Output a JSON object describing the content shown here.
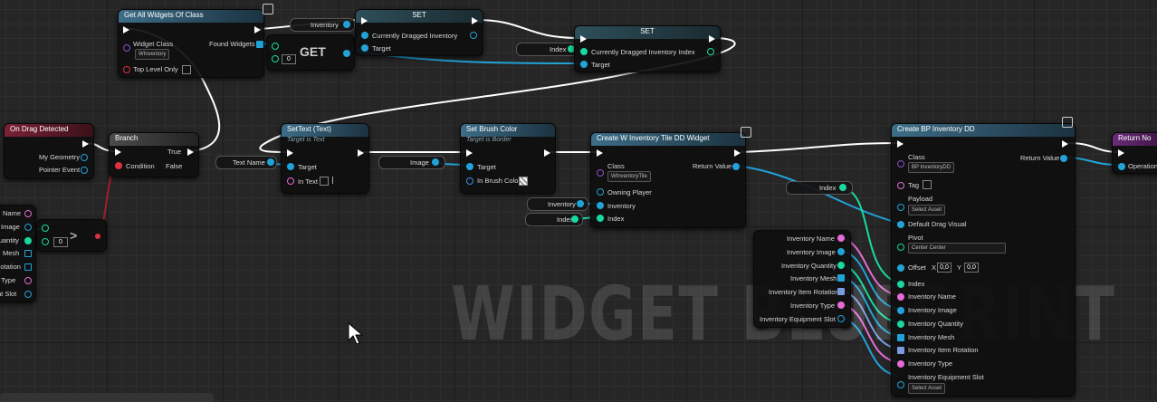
{
  "watermark": "WIDGET BLUEPRINT",
  "colors": {
    "exec": "#ffffff",
    "object": "#22a3d8",
    "int": "#19d9a0",
    "string": "#e66bd6",
    "bool": "#e03040"
  },
  "nodes": {
    "get_all_widgets": {
      "title": "Get All Widgets Of Class",
      "widget_class": "Widget Class",
      "class_value": "WInventory",
      "found_widgets": "Found Widgets",
      "top_level_only": "Top Level Only"
    },
    "get": {
      "title": "GET",
      "index_value": "0"
    },
    "set1": {
      "title": "SET",
      "inventory": "Inventory",
      "pin": "Currently Dragged Inventory",
      "target": "Target"
    },
    "set2": {
      "title": "SET",
      "index": "Index",
      "pin": "Currently Dragged Inventory Index",
      "target": "Target"
    },
    "on_drag": {
      "title": "On Drag Detected",
      "my_geometry": "My Geometry",
      "pointer_event": "Pointer Event"
    },
    "branch": {
      "title": "Branch",
      "condition": "Condition",
      "true": "True",
      "false": "False"
    },
    "settext": {
      "title": "SetText (Text)",
      "subtitle": "Target is Text",
      "target": "Target",
      "in_text": "In Text",
      "text_name": "Text Name"
    },
    "setbrush": {
      "title": "Set Brush Color",
      "subtitle": "Target is Border",
      "target": "Target",
      "in_brush": "In Brush Color",
      "image": "Image"
    },
    "create_w": {
      "title": "Create W Inventory Tile DD Widget",
      "class": "Class",
      "class_value": "WInventoryTile",
      "return_value": "Return Value",
      "owning_player": "Owning Player",
      "inventory": "Inventory",
      "index": "Index",
      "inv_reroute": "Inventory",
      "index_reroute": "Index"
    },
    "create_bp": {
      "title": "Create BP Inventory DD",
      "class": "Class",
      "class_value": "BP InventoryDD",
      "return_value": "Return Value",
      "tag": "Tag",
      "payload": "Payload",
      "payload_value": "Select Asset",
      "default_drag": "Default Drag Visual",
      "pivot": "Pivot",
      "pivot_value": "Center Center",
      "offset": "Offset",
      "offset_x_label": "X",
      "offset_x": "0,0",
      "offset_y_label": "Y",
      "offset_y": "0,0",
      "index": "Index",
      "inv_name": "Inventory Name",
      "inv_image": "Inventory Image",
      "inv_quantity": "Inventory Quantity",
      "inv_mesh": "Inventory Mesh",
      "inv_rotation": "Inventory Item Rotation",
      "inv_type": "Inventory Type",
      "inv_slot": "Inventory Equipment Slot",
      "slot_value": "Select Asset"
    },
    "return_node": {
      "title": "Return No",
      "operation": "Operation"
    },
    "index_reroute": {
      "label": "Index"
    },
    "left_vars": [
      "Name",
      "Image",
      "Quantity",
      "Mesh",
      "Rotation",
      "Type",
      "nt Slot"
    ],
    "compare": {
      "value": "0"
    },
    "var_list": [
      "Inventory Name",
      "Inventory Image",
      "Inventory Quantity",
      "Inventory Mesh",
      "Inventory Item Rotation",
      "Inventory Type",
      "Inventory Equipment Slot"
    ]
  }
}
